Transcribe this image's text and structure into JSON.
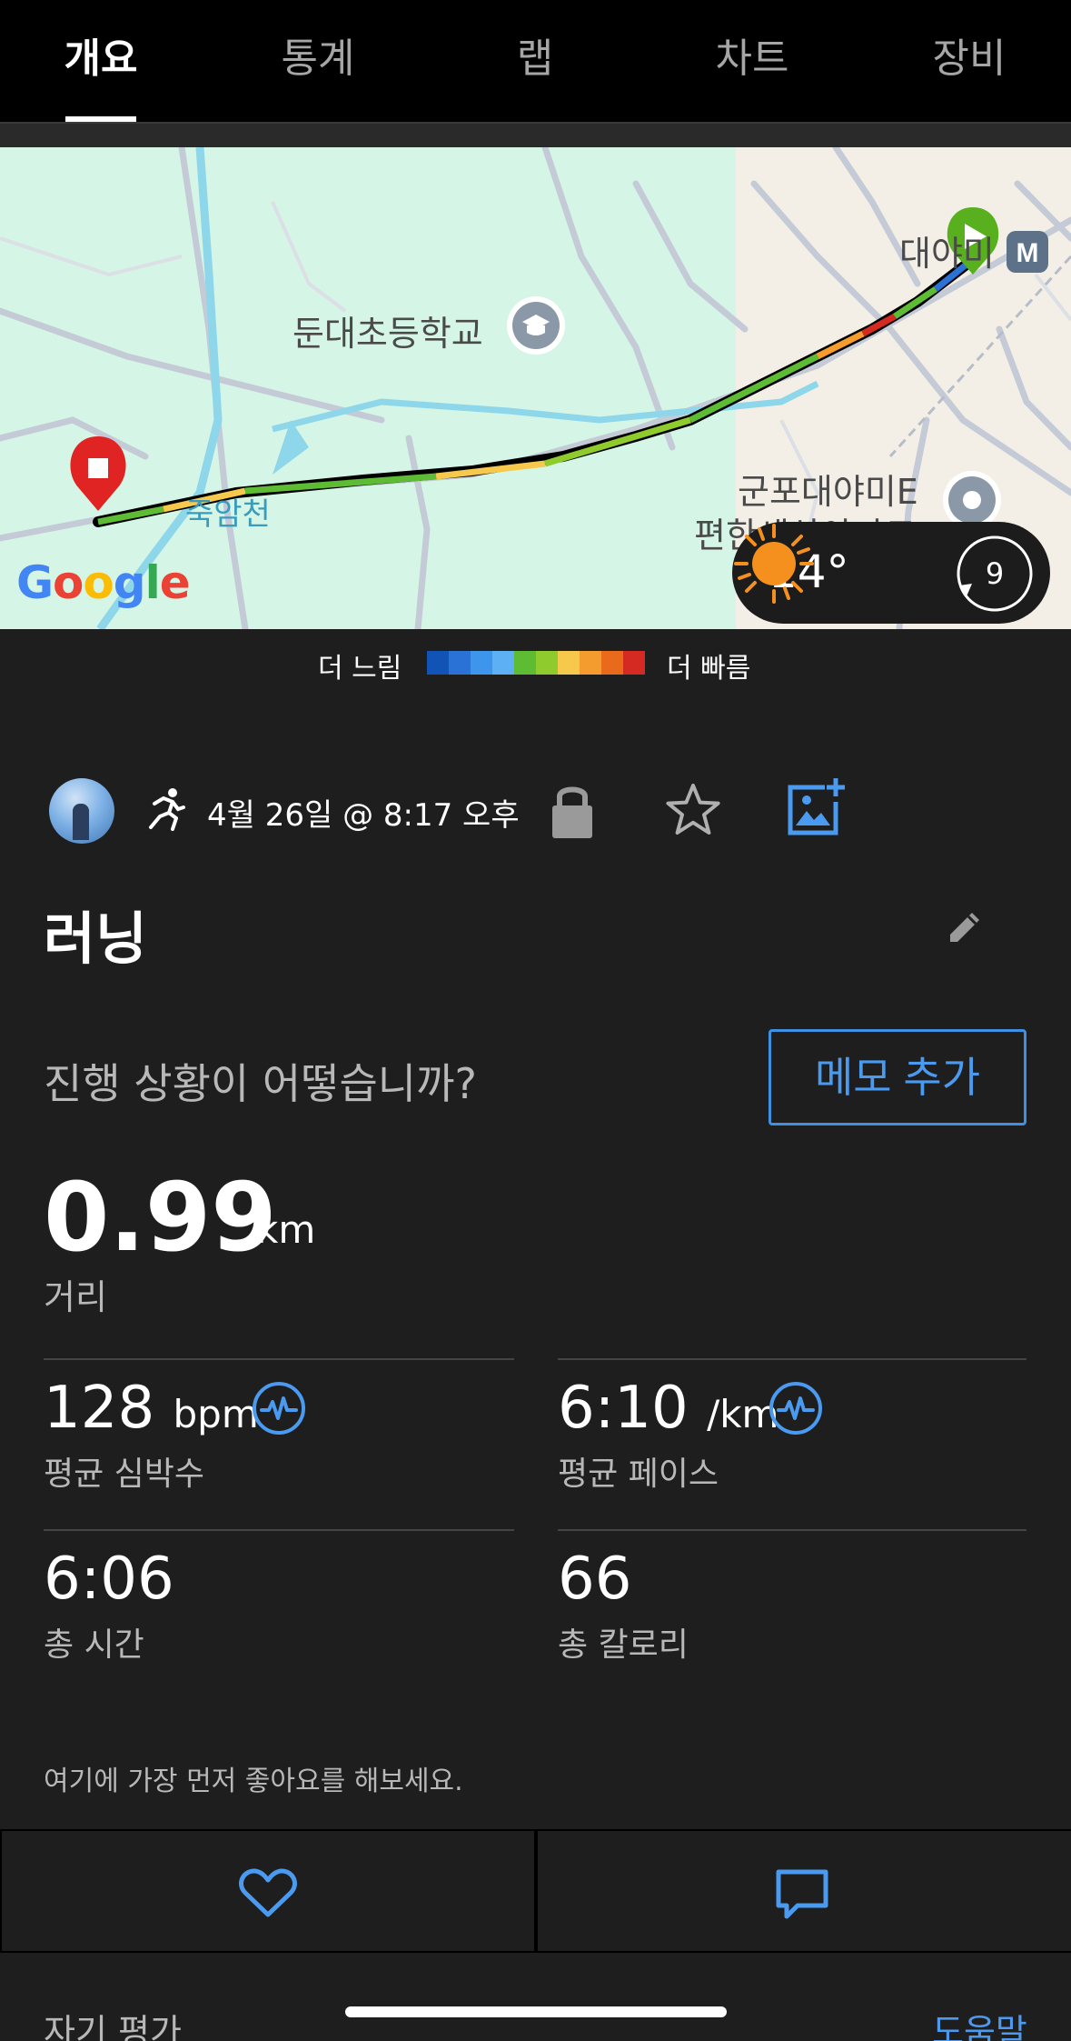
{
  "tabs": [
    {
      "label": "개요",
      "active": true
    },
    {
      "label": "통계",
      "active": false
    },
    {
      "label": "랩",
      "active": false
    },
    {
      "label": "차트",
      "active": false
    },
    {
      "label": "장비",
      "active": false
    }
  ],
  "map": {
    "labels": {
      "school": "둔대초등학교",
      "station": "대야미",
      "stream": "죽암천",
      "apartment_line1": "군포대야미E",
      "apartment_line2": "편한세상아파트"
    },
    "logo": "Google",
    "weather": {
      "temperature": "14°",
      "wind": "9"
    }
  },
  "legend": {
    "slow_label": "더 느림",
    "fast_label": "더 빠름",
    "colors": [
      "#1254b5",
      "#2a72d6",
      "#3d95ec",
      "#5db0f3",
      "#5dbb34",
      "#8fcb2c",
      "#f6c94c",
      "#f59c2f",
      "#ea6a1b",
      "#d42a22"
    ]
  },
  "activity": {
    "datetime": "4월 26일 @ 8:17 오후",
    "title": "러닝",
    "progress_question": "진행 상황이 어떻습니까?",
    "memo_button": "메모 추가",
    "distance": {
      "value": "0.99",
      "unit": "km",
      "label": "거리"
    },
    "stats": [
      {
        "value": "128",
        "unit": "bpm",
        "label": "평균 심박수"
      },
      {
        "value": "6:10",
        "unit": "/km",
        "label": "평균 페이스"
      },
      {
        "value": "6:06",
        "unit": "",
        "label": "총 시간"
      },
      {
        "value": "66",
        "unit": "",
        "label": "총 칼로리"
      }
    ],
    "first_like": "여기에 가장 먼저 좋아요를 해보세요."
  },
  "footer": {
    "self_evaluation": "자기 평가",
    "help": "도움말"
  },
  "colors": {
    "accent": "#4a9af0",
    "background": "#1e1e1f",
    "start_marker": "#58b01e",
    "end_marker": "#e02424"
  }
}
